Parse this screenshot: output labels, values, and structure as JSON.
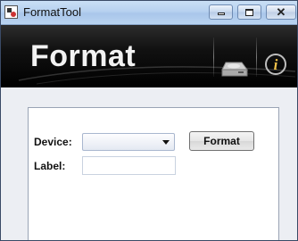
{
  "window": {
    "title": "FormatTool",
    "icon": "app-icon",
    "controls": [
      "minimize-icon",
      "maximize-icon",
      "close-icon"
    ]
  },
  "banner": {
    "title": "Format",
    "icons": [
      "drive-icon",
      "info-icon"
    ]
  },
  "form": {
    "device_label": "Device:",
    "device_value": "",
    "format_button": "Format",
    "label_label": "Label:",
    "label_value": ""
  }
}
